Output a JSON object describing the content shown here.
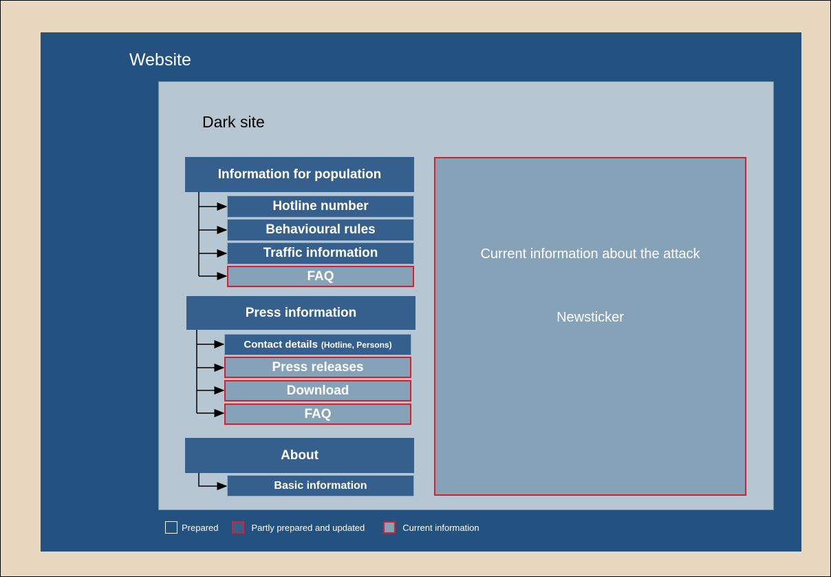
{
  "website": {
    "title": "Website"
  },
  "darksite": {
    "title": "Dark site"
  },
  "sections": {
    "population": {
      "title": "Information for population",
      "items": [
        "Hotline number",
        "Behavioural rules",
        "Traffic information",
        "FAQ"
      ]
    },
    "press": {
      "title": "Press information",
      "contact_label": "Contact details",
      "contact_note": "(Hotline, Persons)",
      "items": [
        "Press releases",
        "Download",
        "FAQ"
      ]
    },
    "about": {
      "title": "About",
      "items": [
        "Basic information"
      ]
    }
  },
  "newsbox": {
    "current": "Current information about the attack",
    "ticker": "Newsticker"
  },
  "legend": {
    "prepared": "Prepared",
    "partly": "Partly prepared and updated",
    "current": "Current information"
  },
  "colors": {
    "background": "#e8d8c0",
    "website": "#235180",
    "darksite": "#b6c6d2",
    "prepared": "#35608d",
    "current": "#85a2b8",
    "highlight_border": "#d81f2a"
  }
}
